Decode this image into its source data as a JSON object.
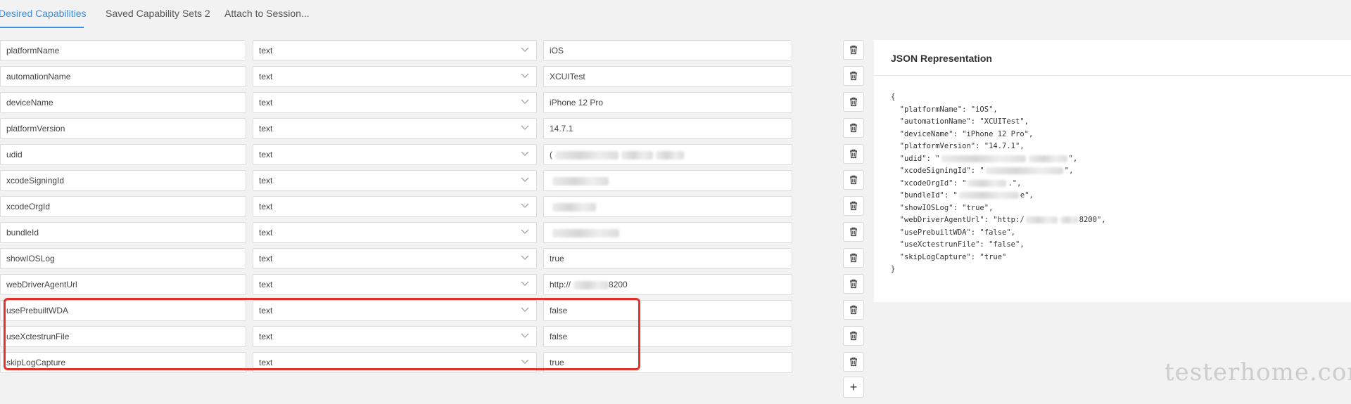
{
  "tabs": [
    {
      "label": "Desired Capabilities",
      "active": true
    },
    {
      "label": "Saved Capability Sets 2",
      "active": false
    },
    {
      "label": "Attach to Session...",
      "active": false
    }
  ],
  "capabilities": [
    {
      "name": "platformName",
      "type": "text",
      "value": "iOS"
    },
    {
      "name": "automationName",
      "type": "text",
      "value": "XCUITest"
    },
    {
      "name": "deviceName",
      "type": "text",
      "value": "iPhone 12 Pro"
    },
    {
      "name": "platformVersion",
      "type": "text",
      "value": "14.7.1"
    },
    {
      "name": "udid",
      "type": "text",
      "value": "("
    },
    {
      "name": "xcodeSigningId",
      "type": "text",
      "value": ""
    },
    {
      "name": "xcodeOrgId",
      "type": "text",
      "value": ""
    },
    {
      "name": "bundleId",
      "type": "text",
      "value": ""
    },
    {
      "name": "showIOSLog",
      "type": "text",
      "value": "true"
    },
    {
      "name": "webDriverAgentUrl",
      "type": "text",
      "value": "http://",
      "value_suffix": "8200"
    },
    {
      "name": "usePrebuiltWDA",
      "type": "text",
      "value": "false"
    },
    {
      "name": "useXctestrunFile",
      "type": "text",
      "value": "false"
    },
    {
      "name": "skipLogCapture",
      "type": "text",
      "value": "true"
    }
  ],
  "add_label": "+",
  "json_panel": {
    "title": "JSON Representation",
    "lines": [
      "{",
      "  \"platformName\": \"iOS\",",
      "  \"automationName\": \"XCUITest\",",
      "  \"deviceName\": \"iPhone 12 Pro\",",
      "  \"platformVersion\": \"14.7.1\",",
      "  \"udid\": \"",
      "  \"xcodeSigningId\": \"",
      "  \"xcodeOrgId\": \"",
      "  \"bundleId\": \"",
      "  \"showIOSLog\": \"true\",",
      "  \"webDriverAgentUrl\": \"http:/",
      "  \"usePrebuiltWDA\": \"false\",",
      "  \"useXctestrunFile\": \"false\",",
      "  \"skipLogCapture\": \"true\"",
      "}"
    ],
    "line_tails": [
      "",
      "",
      "",
      "",
      "",
      "\",",
      "\",",
      ".\",",
      "e\",",
      "",
      "8200\",",
      "",
      "",
      "",
      ""
    ]
  },
  "watermark": "testerhome.com",
  "colors": {
    "accent": "#3a8ee6",
    "highlight": "#e0322b"
  }
}
